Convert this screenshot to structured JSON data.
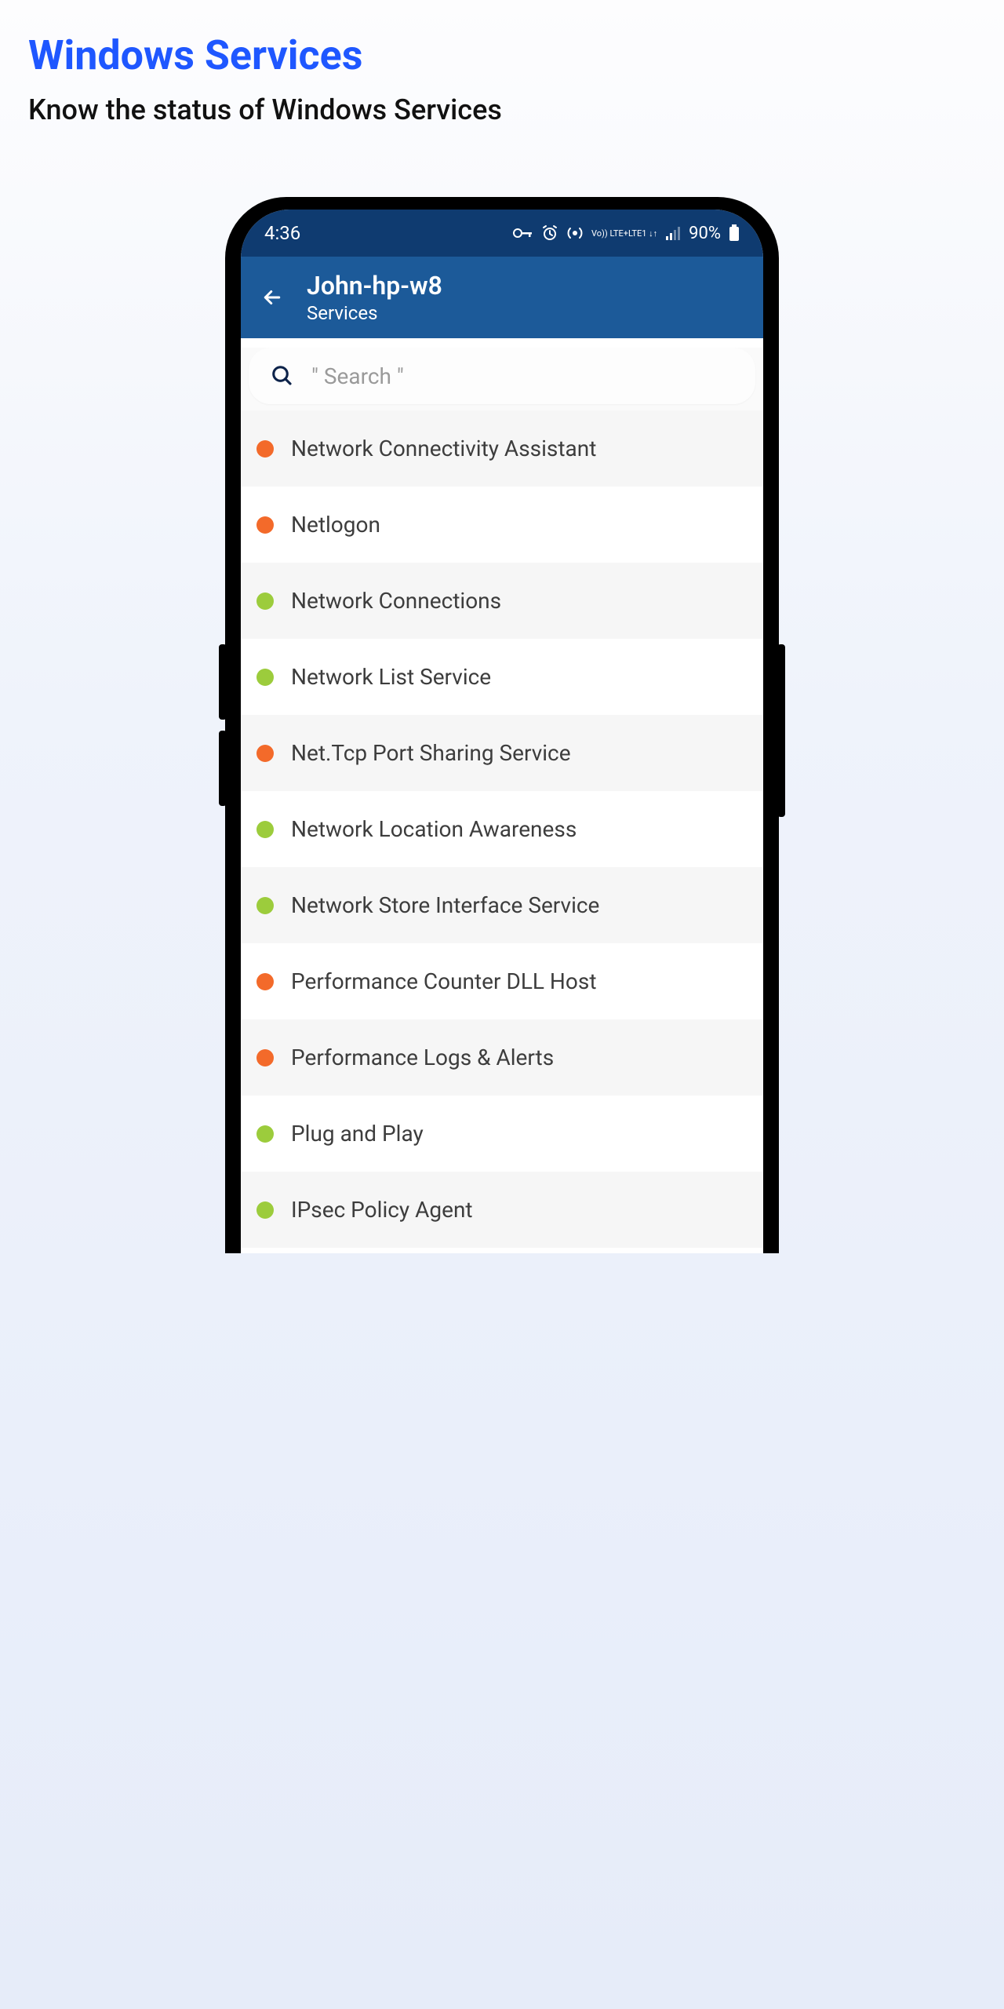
{
  "page": {
    "title": "Windows Services",
    "subtitle": "Know the status of Windows Services"
  },
  "statusbar": {
    "time": "4:36",
    "battery": "90%",
    "network_label": "LTE+",
    "network_sub": "LTE1"
  },
  "appbar": {
    "title": "John-hp-w8",
    "subtitle": "Services"
  },
  "search": {
    "placeholder": "\" Search \""
  },
  "status_colors": {
    "running": "#9ccc3c",
    "stopped": "#f36a2a"
  },
  "services": [
    {
      "name": "Network Connectivity Assistant",
      "status": "stopped"
    },
    {
      "name": "Netlogon",
      "status": "stopped"
    },
    {
      "name": "Network Connections",
      "status": "running"
    },
    {
      "name": "Network List Service",
      "status": "running"
    },
    {
      "name": "Net.Tcp Port Sharing Service",
      "status": "stopped"
    },
    {
      "name": "Network Location Awareness",
      "status": "running"
    },
    {
      "name": "Network Store Interface Service",
      "status": "running"
    },
    {
      "name": "Performance Counter DLL Host",
      "status": "stopped"
    },
    {
      "name": "Performance Logs & Alerts",
      "status": "stopped"
    },
    {
      "name": "Plug and Play",
      "status": "running"
    },
    {
      "name": "IPsec Policy Agent",
      "status": "running"
    }
  ]
}
